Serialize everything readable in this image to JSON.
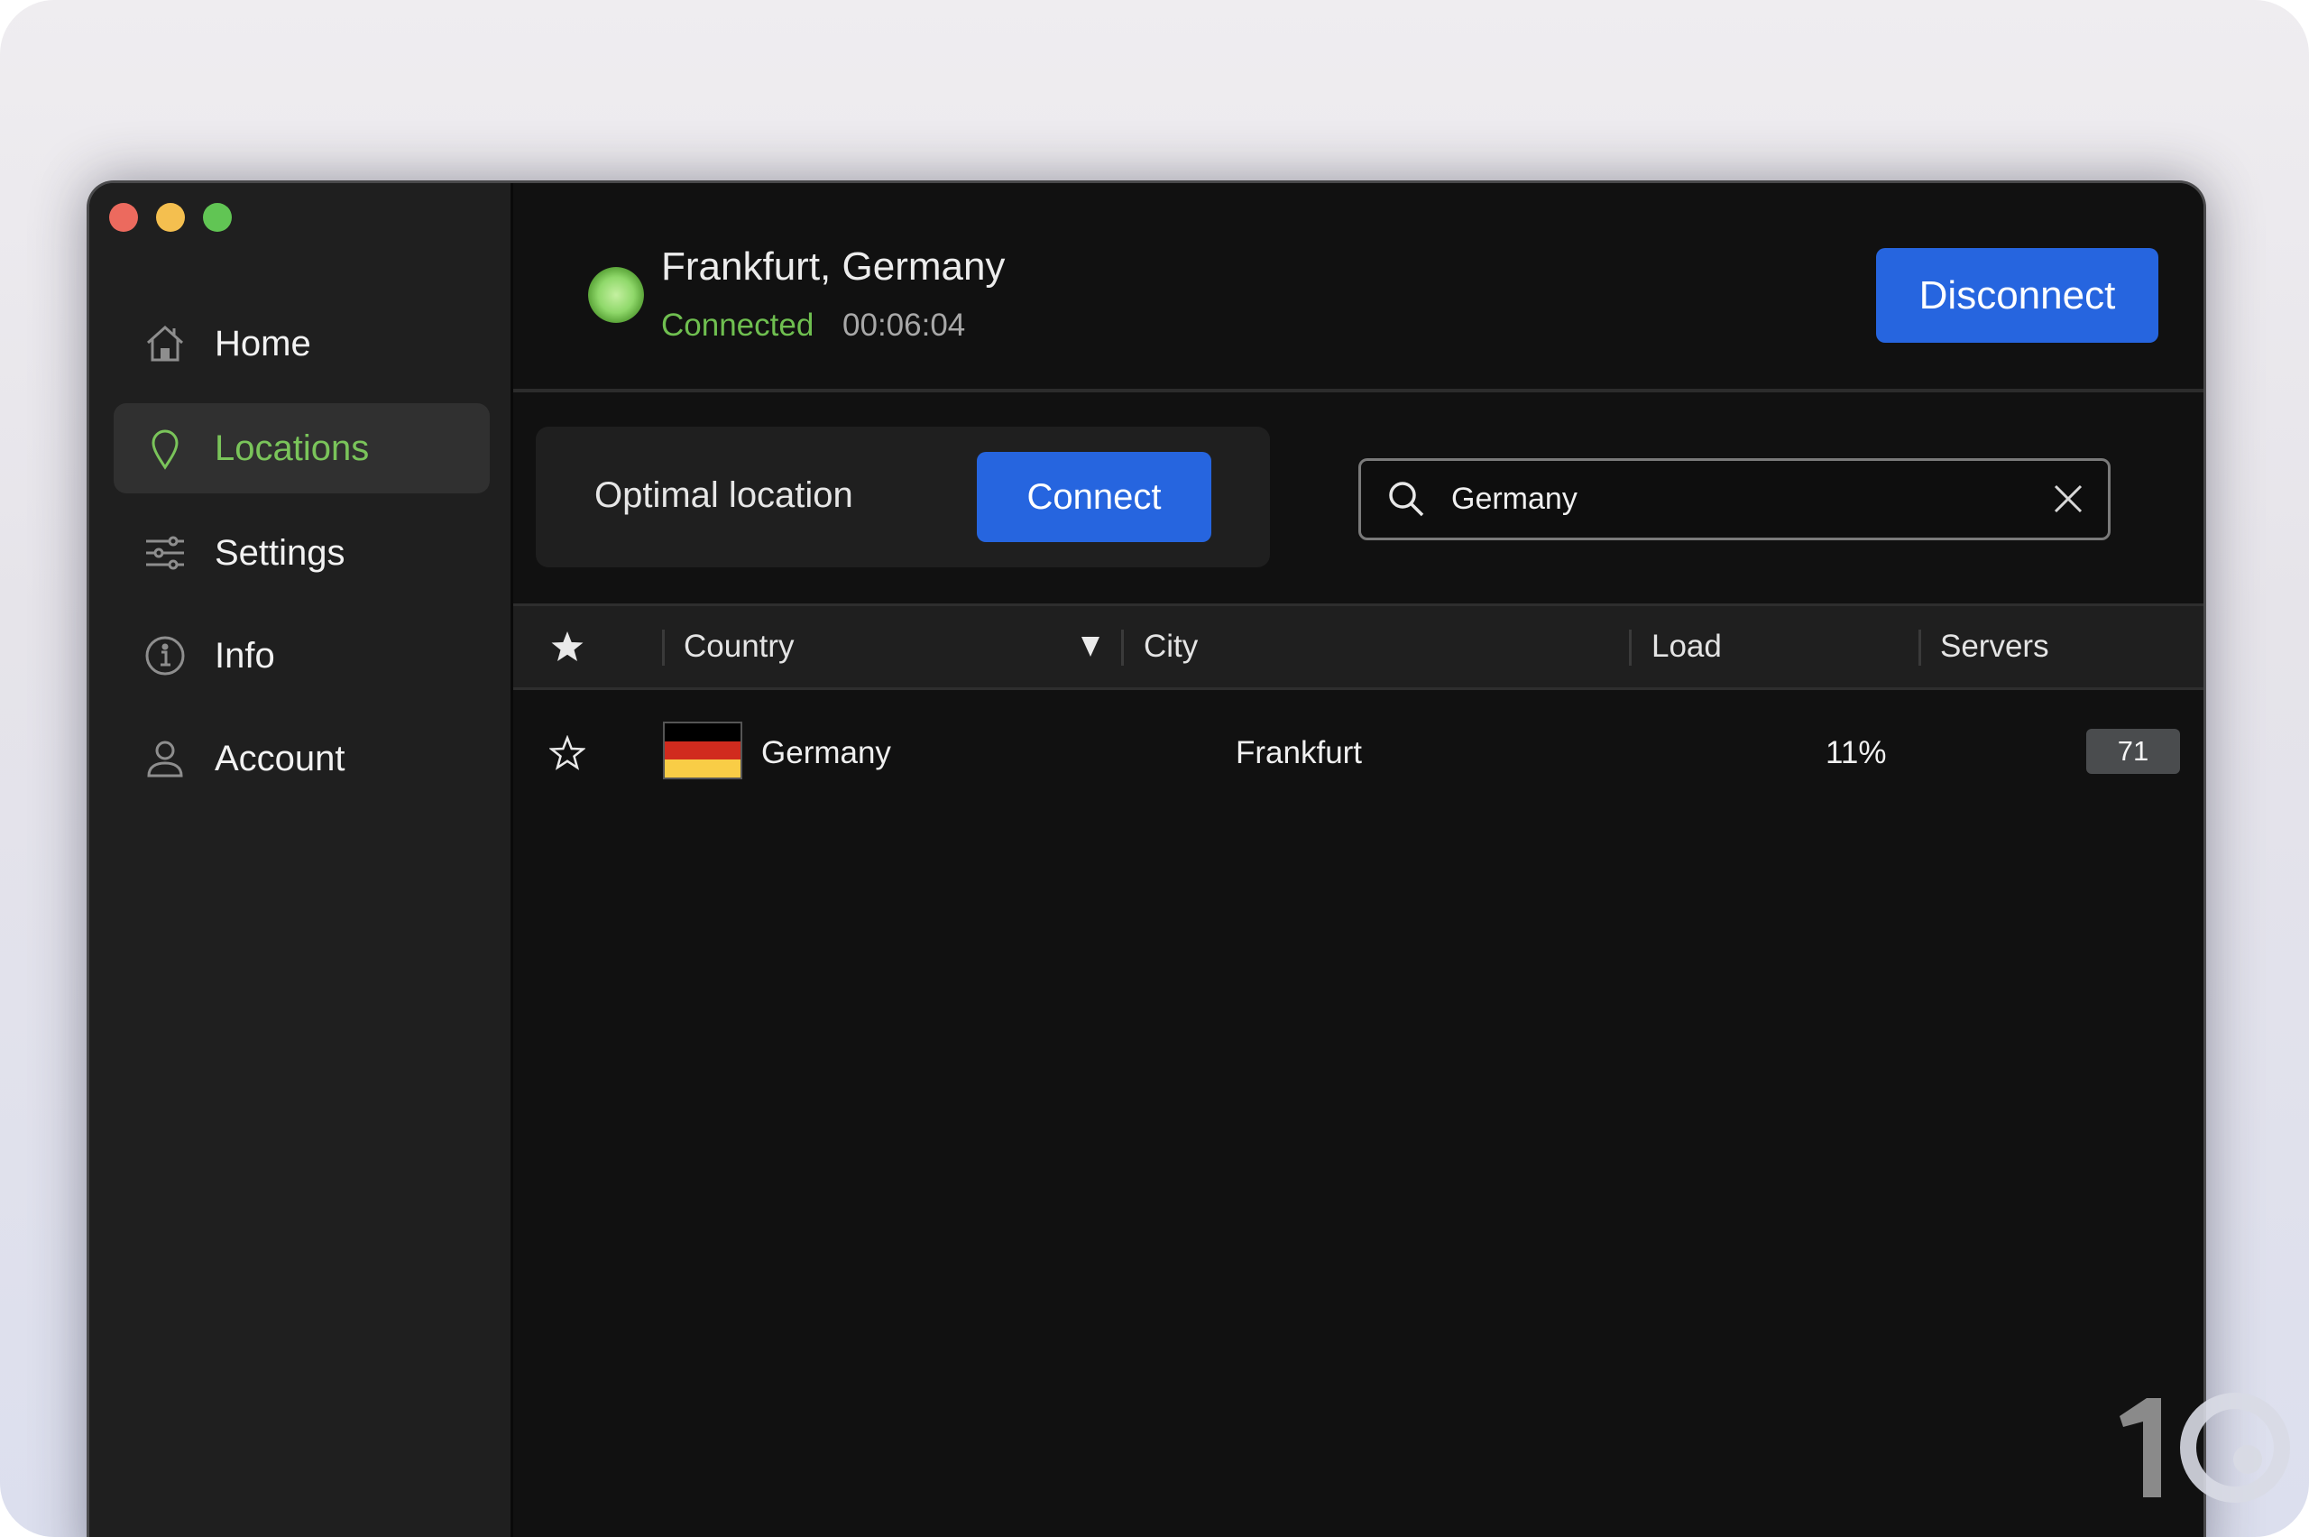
{
  "window": {
    "traffic_lights": [
      "close",
      "minimize",
      "zoom"
    ]
  },
  "sidebar": {
    "items": [
      {
        "label": "Home",
        "icon": "home-icon",
        "active": false
      },
      {
        "label": "Locations",
        "icon": "location-pin-icon",
        "active": true
      },
      {
        "label": "Settings",
        "icon": "sliders-icon",
        "active": false
      },
      {
        "label": "Info",
        "icon": "info-icon",
        "active": false
      },
      {
        "label": "Account",
        "icon": "user-icon",
        "active": false
      }
    ]
  },
  "header": {
    "location": "Frankfurt, Germany",
    "status": "Connected",
    "elapsed": "00:06:04",
    "disconnect_label": "Disconnect"
  },
  "optimal": {
    "label": "Optimal location",
    "connect_label": "Connect"
  },
  "search": {
    "value": "Germany",
    "icon": "search-icon",
    "clear_icon": "close-icon",
    "refresh_icon": "refresh-icon"
  },
  "table": {
    "columns": {
      "favorite": "star-icon",
      "country": "Country",
      "city": "City",
      "load": "Load",
      "servers": "Servers"
    },
    "sort": {
      "column": "Country",
      "direction": "descending"
    },
    "rows": [
      {
        "favorite": false,
        "flag": "germany-flag",
        "country": "Germany",
        "city": "Frankfurt",
        "load": "11%",
        "servers": "71"
      }
    ]
  },
  "colors": {
    "accent_blue": "#2665df",
    "connected_green": "#6fbf50",
    "active_nav_green": "#7ac45a",
    "flag_black": "#000000",
    "flag_red": "#d12b1e",
    "flag_gold": "#f9cd46"
  },
  "watermark": "10"
}
